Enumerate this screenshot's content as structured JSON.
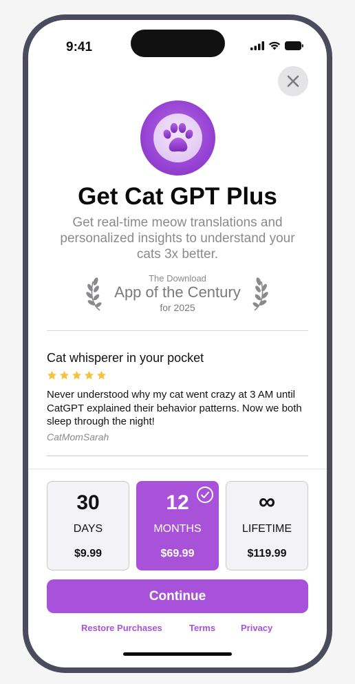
{
  "status_bar": {
    "time": "9:41"
  },
  "header": {
    "title": "Get Cat GPT Plus",
    "subtitle": "Get real-time meow translations and personalized insights to understand your cats 3x better."
  },
  "award": {
    "top": "The Download",
    "main": "App of the Century",
    "bottom": "for 2025"
  },
  "review": {
    "title": "Cat whisperer in your pocket",
    "rating": 5,
    "body": "Never understood why my cat went crazy at 3 AM until CatGPT explained their behavior patterns. Now we both sleep through the night!",
    "author": "CatMomSarah"
  },
  "plans": [
    {
      "amount": "30",
      "unit": "DAYS",
      "price": "$9.99",
      "selected": false
    },
    {
      "amount": "12",
      "unit": "MONTHS",
      "price": "$69.99",
      "selected": true
    },
    {
      "amount": "∞",
      "unit": "LIFETIME",
      "price": "$119.99",
      "selected": false
    }
  ],
  "continue_label": "Continue",
  "links": {
    "restore": "Restore Purchases",
    "terms": "Terms",
    "privacy": "Privacy"
  },
  "colors": {
    "accent": "#a852d9",
    "star": "#f5c33b",
    "frame": "#4a4b5c"
  },
  "icons": [
    "close-icon",
    "paw-icon",
    "laurel-icon",
    "star-icon",
    "checkmark-circle-icon",
    "signal-icon",
    "wifi-icon",
    "battery-icon"
  ]
}
